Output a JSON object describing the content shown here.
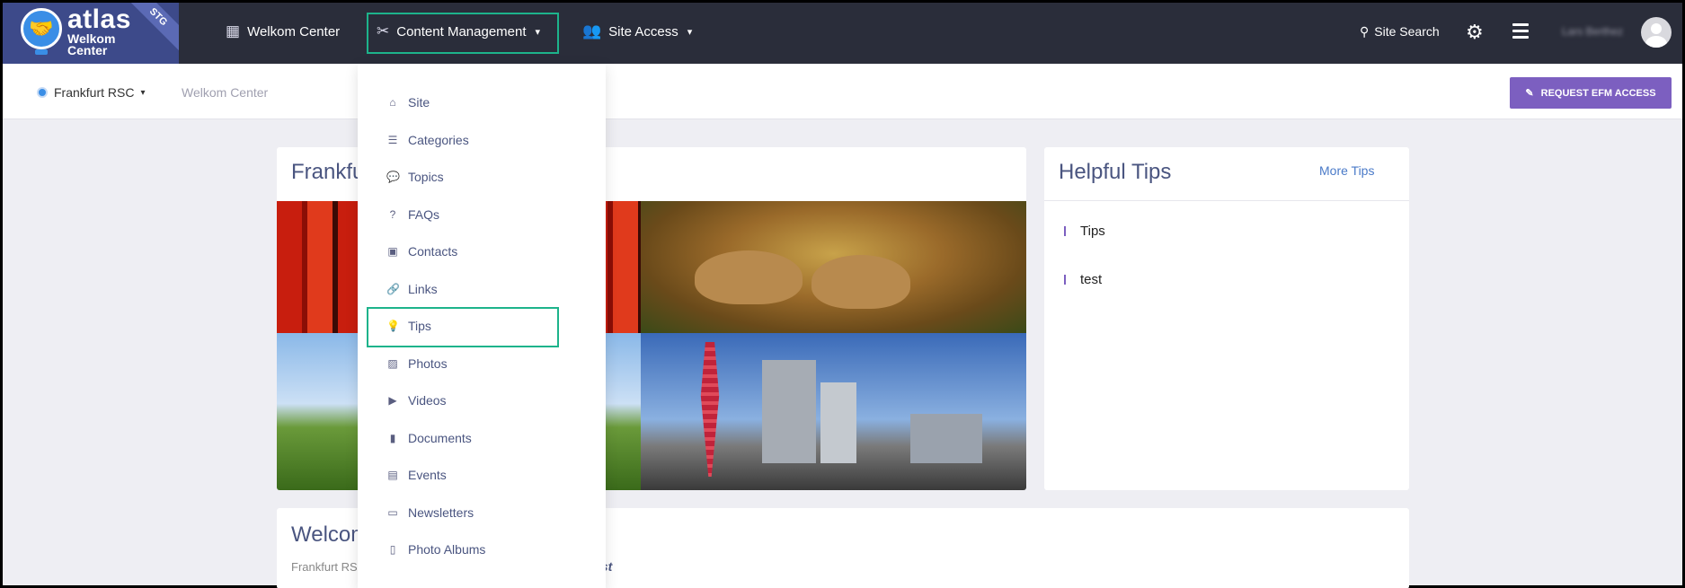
{
  "brand": {
    "name": "atlas",
    "subtitle_line1": "Welkom",
    "subtitle_line2": "Center",
    "env_badge": "STG"
  },
  "topnav": {
    "items": [
      {
        "label": "Welkom Center",
        "icon": "dashboard-icon"
      },
      {
        "label": "Content Management",
        "icon": "tools-icon",
        "has_dropdown": true,
        "active": true
      },
      {
        "label": "Site Access",
        "icon": "users-icon",
        "has_dropdown": true
      }
    ],
    "search_label": "Site Search",
    "user_name": "Lars Berthez"
  },
  "subbar": {
    "location": "Frankfurt RSC",
    "breadcrumb": "Welkom Center",
    "efm_button": "REQUEST EFM ACCESS"
  },
  "main_card": {
    "title": "Frankfurt RSC"
  },
  "tips_card": {
    "title": "Helpful Tips",
    "more_link": "More Tips",
    "items": [
      "Tips",
      "test"
    ]
  },
  "welcome_card": {
    "title": "Welcome",
    "subtitle": "Frankfurt RSC",
    "emphasis": "est"
  },
  "dropdown": {
    "items": [
      {
        "label": "Site",
        "icon": "home-icon"
      },
      {
        "label": "Categories",
        "icon": "list-icon"
      },
      {
        "label": "Topics",
        "icon": "comments-icon"
      },
      {
        "label": "FAQs",
        "icon": "question-icon"
      },
      {
        "label": "Contacts",
        "icon": "contact-card-icon"
      },
      {
        "label": "Links",
        "icon": "link-icon"
      },
      {
        "label": "Tips",
        "icon": "lightbulb-icon",
        "highlighted": true
      },
      {
        "label": "Photos",
        "icon": "images-icon"
      },
      {
        "label": "Videos",
        "icon": "video-icon"
      },
      {
        "label": "Documents",
        "icon": "file-icon"
      },
      {
        "label": "Events",
        "icon": "calendar-icon"
      },
      {
        "label": "Newsletters",
        "icon": "newspaper-icon"
      },
      {
        "label": "Photo Albums",
        "icon": "book-icon"
      }
    ]
  },
  "colors": {
    "topbar": "#2a2d3a",
    "accent_purple": "#7c5fc0",
    "highlight_green": "#1db38b",
    "title_text": "#4a5580"
  }
}
